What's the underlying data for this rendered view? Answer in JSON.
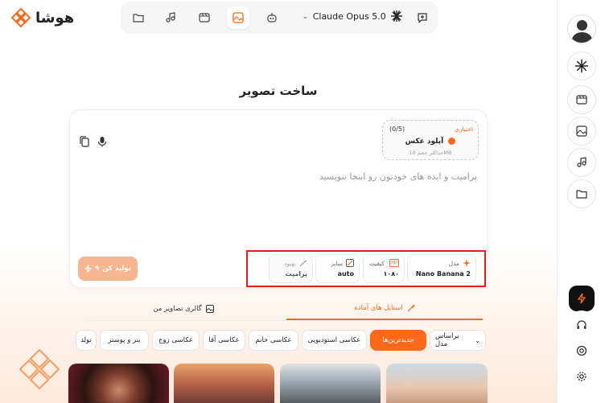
{
  "app": {
    "name": "هوشا"
  },
  "topnav": {
    "items": [
      {
        "icon": "folder-icon"
      },
      {
        "icon": "music-icon"
      },
      {
        "icon": "video-icon"
      },
      {
        "icon": "image-icon",
        "active": true
      },
      {
        "icon": "robot-icon"
      }
    ],
    "model_label": "Claude Opus 5.0",
    "new_chat_icon": "new-chat-icon"
  },
  "page": {
    "title": "ساخت تصویر"
  },
  "upload": {
    "optional": "اختیاری",
    "count": "(0/5)",
    "title": "آپلود عکس",
    "note": "حداکثر حجم 10MB"
  },
  "prompt": {
    "placeholder": "پرامپت و ایده های خودتون رو اینجا بنویسید"
  },
  "generate": {
    "label": "تولید کن",
    "cost": "۹"
  },
  "options": {
    "model": {
      "label": "مدل",
      "value": "Nano Banana 2"
    },
    "quality": {
      "label": "کیفیت",
      "value": "۱۰۸۰",
      "badge": "HD"
    },
    "size": {
      "label": "سایز",
      "value": "auto"
    },
    "enhance": {
      "label": "بهبود",
      "value": "پرامپت"
    }
  },
  "tabs": [
    {
      "label": "استایل های آماده",
      "active": true
    },
    {
      "label": "گالری تصاویر من",
      "active": false
    }
  ],
  "filters": {
    "sort_label": "براساس مدل",
    "items": [
      {
        "label": "جدیدترین‌ها",
        "active": true
      },
      {
        "label": "عکاسی استودیویی"
      },
      {
        "label": "عکاسی خانم"
      },
      {
        "label": "عکاسی آقا"
      },
      {
        "label": "عکاسی زوج"
      },
      {
        "label": "بنر و پوستر"
      },
      {
        "label": "تولد"
      }
    ]
  },
  "colors": {
    "accent": "#ff6a1a",
    "highlight_box": "#e21b1b"
  }
}
